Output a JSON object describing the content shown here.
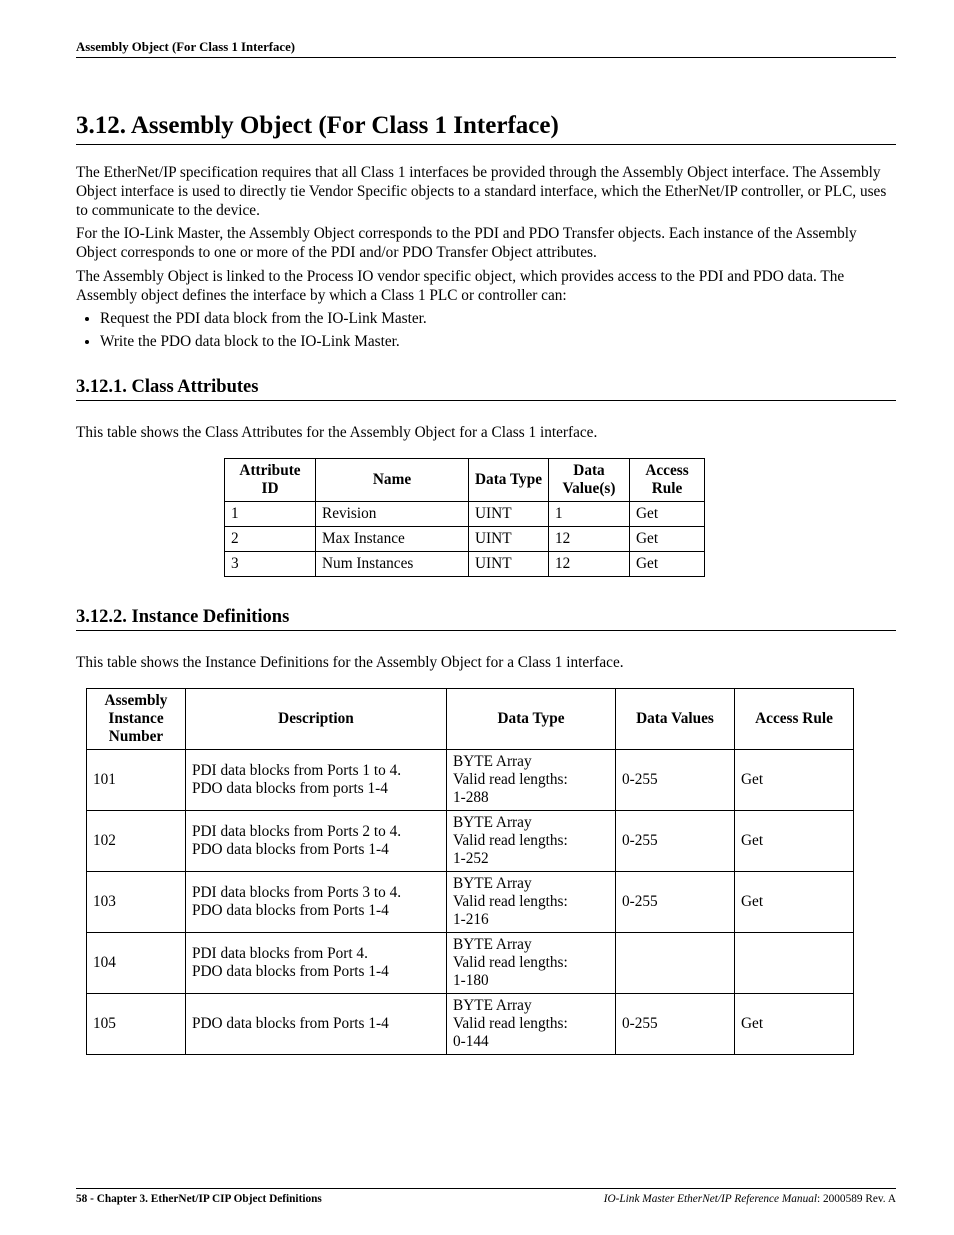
{
  "running_header": "Assembly Object (For Class 1 Interface)",
  "section": {
    "number": "3.12.",
    "title": "Assembly Object (For Class 1 Interface)"
  },
  "paragraphs": {
    "p1": "The EtherNet/IP specification requires that all Class 1 interfaces be provided through the Assembly Object interface. The Assembly Object interface is used to directly tie Vendor Specific objects to a standard interface, which the EtherNet/IP controller, or PLC, uses to communicate to the device.",
    "p2": "For the IO-Link Master, the Assembly Object corresponds to the PDI and PDO Transfer objects. Each instance of the Assembly Object corresponds to one or more of the PDI and/or PDO Transfer Object attributes.",
    "p3": "The Assembly Object is linked to the Process IO vendor specific object, which provides access to the PDI and PDO data. The Assembly object defines the interface by which a Class 1 PLC or controller can:"
  },
  "bullets": [
    "Request the PDI data block from the IO-Link Master.",
    "Write the PDO data block to the IO-Link Master."
  ],
  "subsection1": {
    "number": "3.12.1.",
    "title": "Class Attributes",
    "intro": "This table shows the Class Attributes for the Assembly Object for a Class 1 interface.",
    "headers": [
      "Attribute ID",
      "Name",
      "Data Type",
      "Data Value(s)",
      "Access Rule"
    ],
    "rows": [
      {
        "id": "1",
        "name": "Revision",
        "dtype": "UINT",
        "val": "1",
        "rule": "Get"
      },
      {
        "id": "2",
        "name": "Max Instance",
        "dtype": "UINT",
        "val": "12",
        "rule": "Get"
      },
      {
        "id": "3",
        "name": "Num Instances",
        "dtype": "UINT",
        "val": "12",
        "rule": "Get"
      }
    ]
  },
  "subsection2": {
    "number": "3.12.2.",
    "title": "Instance Definitions",
    "intro": "This table shows the Instance Definitions for the Assembly Object for a Class 1 interface.",
    "headers": [
      "Assembly Instance Number",
      "Description",
      "Data Type",
      "Data Values",
      "Access Rule"
    ],
    "rows": [
      {
        "num": "101",
        "desc": "PDI data blocks from Ports 1 to 4.\nPDO data blocks from ports 1-4",
        "dtype": "BYTE Array\nValid read lengths:\n1-288",
        "vals": "0-255",
        "rule": "Get"
      },
      {
        "num": "102",
        "desc": "PDI data blocks from Ports 2 to 4.\nPDO data blocks from Ports 1-4",
        "dtype": "BYTE Array\nValid read lengths:\n1-252",
        "vals": "0-255",
        "rule": "Get"
      },
      {
        "num": "103",
        "desc": "PDI data blocks from Ports 3 to 4.\nPDO data blocks from Ports 1-4",
        "dtype": "BYTE Array\nValid read lengths:\n1-216",
        "vals": "0-255",
        "rule": "Get"
      },
      {
        "num": "104",
        "desc": "PDI data blocks from Port 4.\nPDO data blocks from Ports 1-4",
        "dtype": "BYTE Array\nValid read lengths:\n1-180",
        "vals": "",
        "rule": ""
      },
      {
        "num": "105",
        "desc": "PDO data blocks from Ports 1-4",
        "dtype": "BYTE Array\nValid read lengths:\n0-144",
        "vals": "0-255",
        "rule": "Get"
      }
    ]
  },
  "footer": {
    "left_page": "58 - ",
    "left_text": "Chapter 3. EtherNet/IP CIP Object Definitions",
    "right_italic": "IO-Link Master EtherNet/IP Reference Manual",
    "right_tail": ": 2000589 Rev. A"
  }
}
